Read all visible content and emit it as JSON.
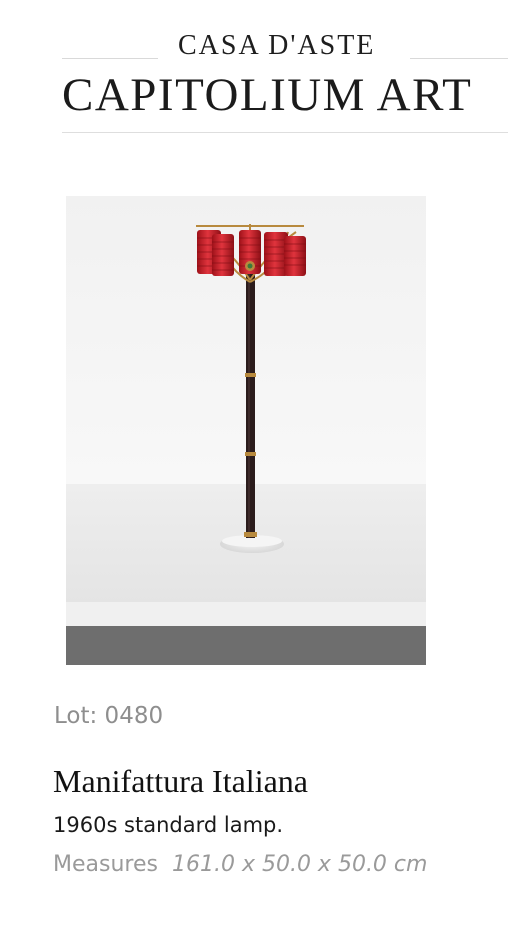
{
  "header": {
    "logo_top": "CASA D'ASTE",
    "logo_main": "CAPITOLIUM ART"
  },
  "lot": {
    "label": "Lot: 0480",
    "artist": "Manifattura Italiana",
    "description": "1960s standard lamp.",
    "measures_label": "Measures",
    "measures_value": "161.0 x 50.0 x 50.0 cm"
  },
  "colors": {
    "lamp_shade": "#c8202a",
    "lamp_stem": "#2a1a1a",
    "brass": "#b88a3e",
    "marble_base": "#e9e9e9",
    "floor_dark": "#6e6e6e"
  }
}
